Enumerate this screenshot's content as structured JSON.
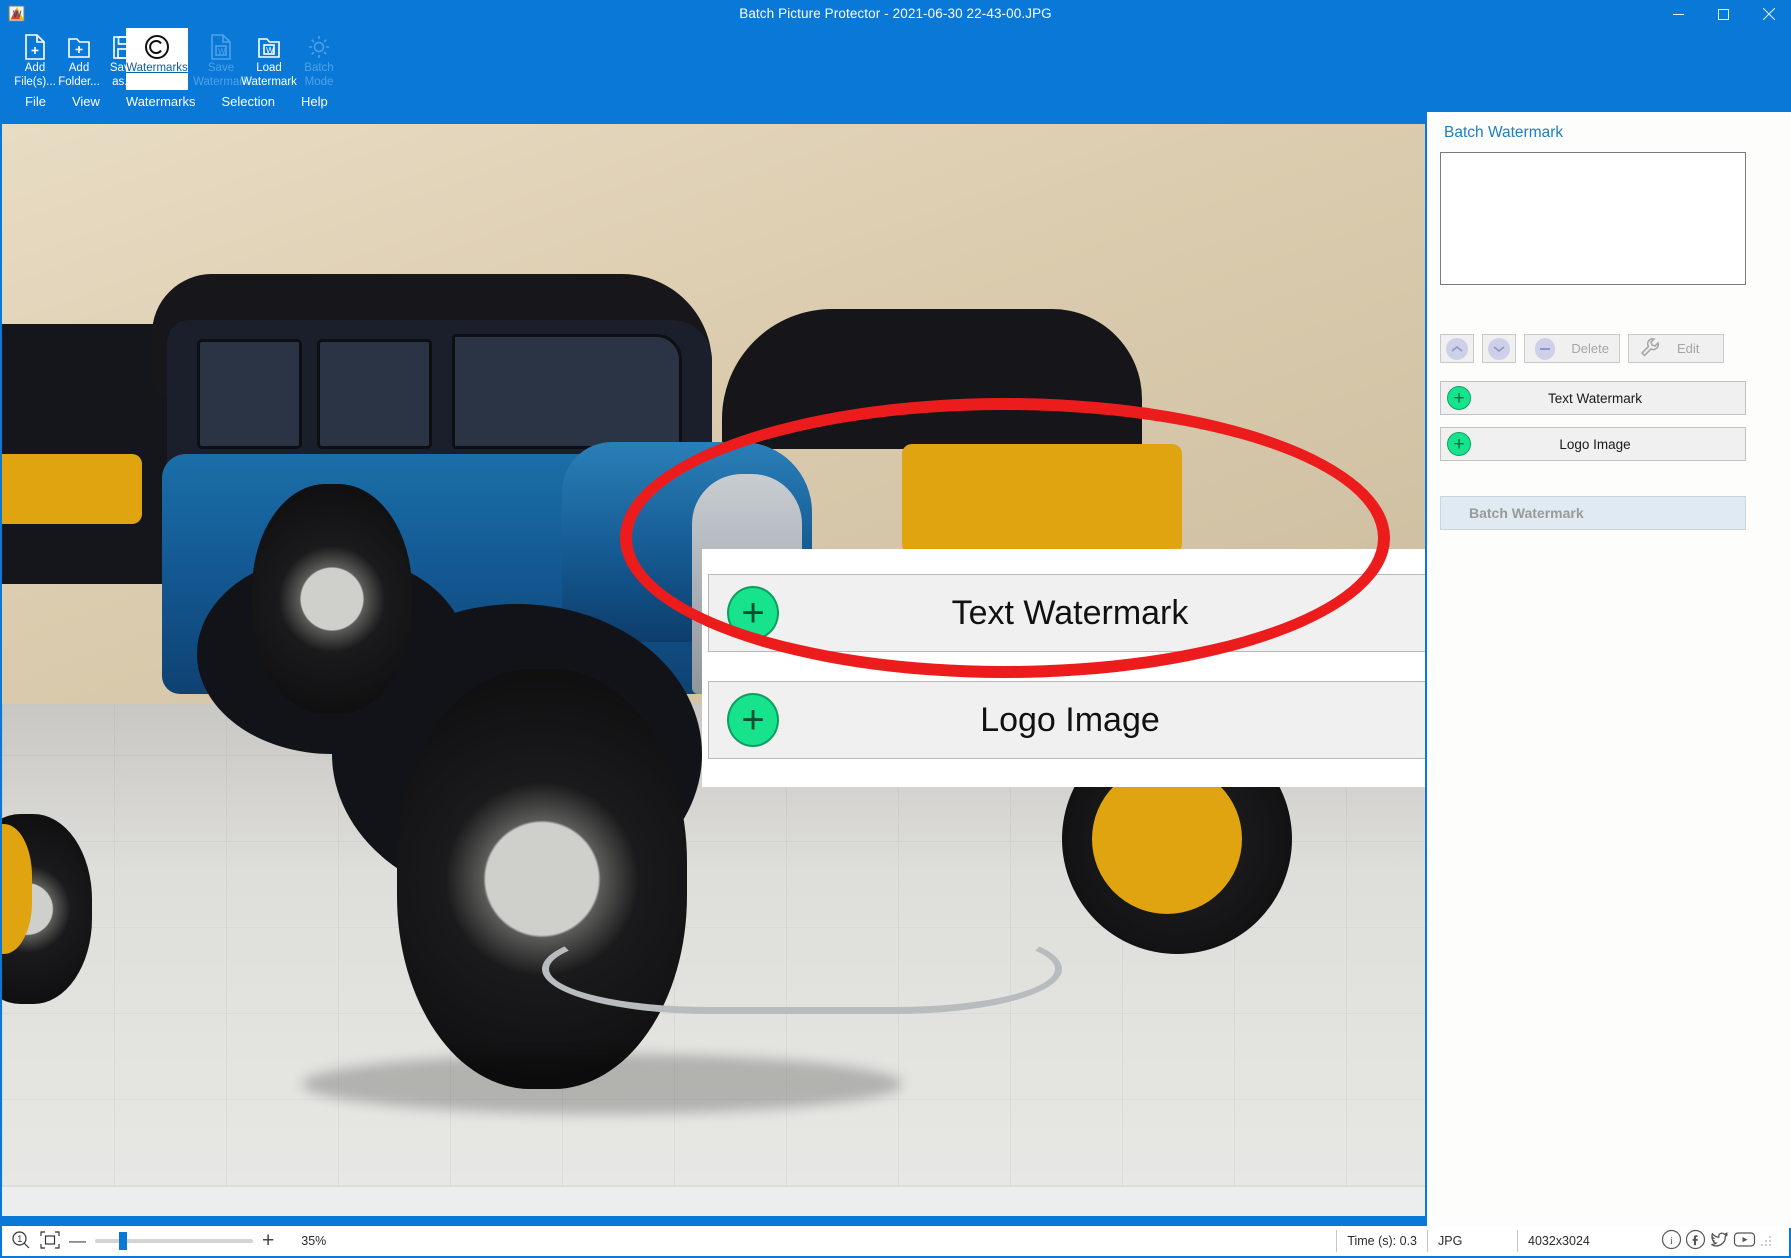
{
  "window": {
    "title": "Batch Picture Protector - 2021-06-30 22-43-00.JPG",
    "app_icon": "app-logo-icon",
    "controls": {
      "minimize": "minimize-icon",
      "maximize": "maximize-icon",
      "close": "close-icon"
    }
  },
  "toolbar": {
    "items": [
      {
        "id": "add-files",
        "label_line1": "Add",
        "label_line2": "File(s)...",
        "icon": "file-plus-icon",
        "enabled": true,
        "active": false
      },
      {
        "id": "add-folder",
        "label_line1": "Add",
        "label_line2": "Folder...",
        "icon": "folder-plus-icon",
        "enabled": true,
        "active": false
      },
      {
        "id": "save-as",
        "label_line1": "Save",
        "label_line2": "as...",
        "icon": "save-disk-icon",
        "enabled": true,
        "active": false
      },
      {
        "id": "watermarks",
        "label_line1": "Watermarks",
        "label_line2": "",
        "icon": "copyright-icon",
        "enabled": true,
        "active": true
      },
      {
        "id": "save-watermark",
        "label_line1": "Save",
        "label_line2": "Watermark",
        "icon": "w-file-icon",
        "enabled": false,
        "active": false
      },
      {
        "id": "load-watermark",
        "label_line1": "Load",
        "label_line2": "Watermark",
        "icon": "w-folder-icon",
        "enabled": true,
        "active": false
      },
      {
        "id": "batch-mode",
        "label_line1": "Batch",
        "label_line2": "Mode",
        "icon": "gear-icon",
        "enabled": false,
        "active": false
      }
    ]
  },
  "menubar": {
    "items": [
      {
        "id": "file",
        "label": "File"
      },
      {
        "id": "view",
        "label": "View"
      },
      {
        "id": "watermarks",
        "label": "Watermarks"
      },
      {
        "id": "selection",
        "label": "Selection"
      },
      {
        "id": "help",
        "label": "Help"
      }
    ]
  },
  "sidepanel": {
    "title": "Batch Watermark",
    "list_items": [],
    "tool_buttons": [
      {
        "id": "move-up",
        "label": "",
        "icon": "chevron-up-circle-icon",
        "enabled": false
      },
      {
        "id": "move-down",
        "label": "",
        "icon": "chevron-down-circle-icon",
        "enabled": false
      },
      {
        "id": "delete",
        "label": "Delete",
        "icon": "minus-circle-icon",
        "enabled": false
      },
      {
        "id": "edit",
        "label": "Edit",
        "icon": "wrench-icon",
        "enabled": false
      }
    ],
    "add_buttons": [
      {
        "id": "text-watermark",
        "label": "Text Watermark",
        "icon": "plus-circle-icon"
      },
      {
        "id": "logo-image",
        "label": "Logo Image",
        "icon": "plus-circle-icon"
      }
    ],
    "batch_button": {
      "id": "batch-watermark",
      "label": "Batch Watermark",
      "enabled": false
    }
  },
  "callout": {
    "highlight_color": "#ec1c1c",
    "buttons": [
      {
        "id": "text-watermark",
        "label": "Text Watermark",
        "icon": "plus-circle-icon"
      },
      {
        "id": "logo-image",
        "label": "Logo Image",
        "icon": "plus-circle-icon"
      }
    ]
  },
  "statusbar": {
    "zoom_icon": "zoom-1to1-icon",
    "fit_icon": "fit-to-window-icon",
    "minus_label": "—",
    "plus_label": "+",
    "zoom_percent": "35%",
    "time": "Time (s): 0.3",
    "format": "JPG",
    "dimensions": "4032x3024",
    "social": [
      {
        "id": "info",
        "icon": "info-circle-icon"
      },
      {
        "id": "facebook",
        "icon": "facebook-icon"
      },
      {
        "id": "twitter",
        "icon": "twitter-icon"
      },
      {
        "id": "youtube",
        "icon": "youtube-icon"
      }
    ]
  },
  "colors": {
    "titlebar": "#0a78d7",
    "accent": "#1b7fc4",
    "plus_green": "#18e38d",
    "highlight_red": "#ec1c1c"
  }
}
